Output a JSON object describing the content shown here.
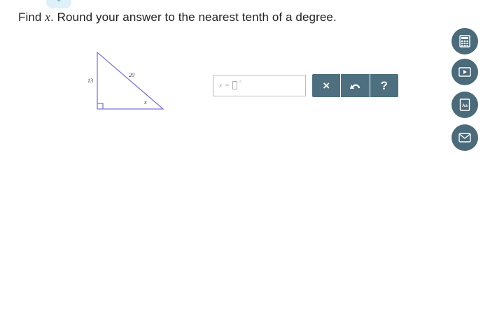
{
  "question": {
    "prefix": "Find ",
    "variable": "x",
    "suffix": ". Round your answer to the nearest tenth of a degree."
  },
  "figure": {
    "labels": {
      "vertical_side": "13",
      "hypotenuse": "20",
      "angle": "x"
    },
    "colors": {
      "triangle_stroke": "#7b76d8"
    }
  },
  "answer": {
    "variable": "x",
    "equals": "=",
    "unit": "°",
    "value": ""
  },
  "toolbar": {
    "clear_label": "×",
    "help_label": "?"
  },
  "sidebar": {
    "items": [
      {
        "icon": "calculator-icon"
      },
      {
        "icon": "play-icon"
      },
      {
        "icon": "glossary-icon",
        "label": "Aa"
      },
      {
        "icon": "mail-icon"
      }
    ]
  },
  "theme": {
    "button_color": "#4d6f7f",
    "tab_color": "#dff1f8"
  }
}
